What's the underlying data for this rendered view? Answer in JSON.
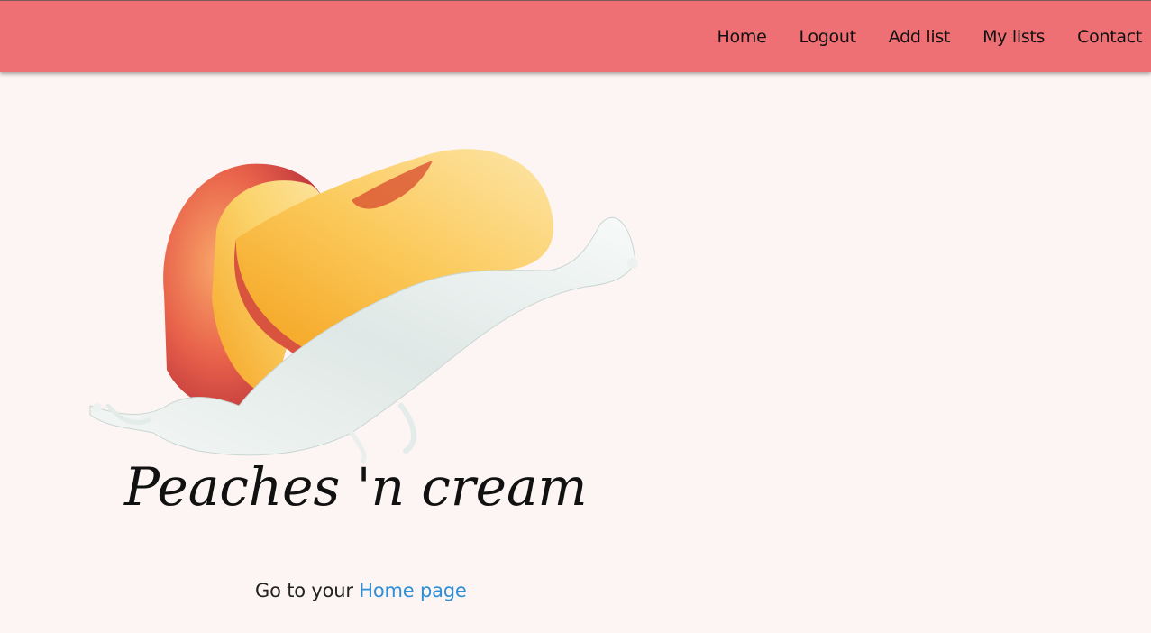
{
  "nav": {
    "items": [
      {
        "label": "Home"
      },
      {
        "label": "Logout"
      },
      {
        "label": "Add list"
      },
      {
        "label": "My lists"
      },
      {
        "label": "Contact"
      }
    ]
  },
  "hero": {
    "brand_text": "Peaches 'n cream"
  },
  "footer": {
    "prefix": "Go to your ",
    "link_label": "Home page"
  },
  "colors": {
    "header_bg": "#ef7074",
    "page_bg": "#fdf5f3",
    "link": "#2f8fd6"
  }
}
